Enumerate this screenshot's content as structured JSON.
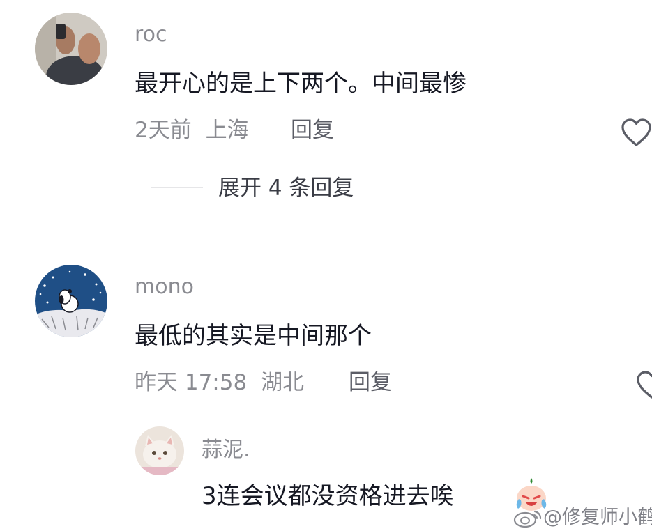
{
  "comments": [
    {
      "username": "roc",
      "text": "最开心的是上下两个。中间最惨",
      "time": "2天前",
      "location": "上海",
      "reply_label": "回复",
      "expand_label": "展开 4 条回复"
    },
    {
      "username": "mono",
      "text": "最低的其实是中间那个",
      "time": "昨天 17:58",
      "location": "湖北",
      "reply_label": "回复",
      "replies": [
        {
          "username": "蒜泥.",
          "text": "3连会议都没资格进去唉"
        }
      ]
    }
  ],
  "watermark": {
    "text": "@修复师小鹤"
  },
  "icons": {
    "like": "heart-outline-icon",
    "emoji": "crying-emoji-icon",
    "weibo": "weibo-logo-icon"
  },
  "colors": {
    "primary_text": "#161823",
    "secondary_text": "#8a8b91",
    "reply_text": "#5b5d66"
  }
}
